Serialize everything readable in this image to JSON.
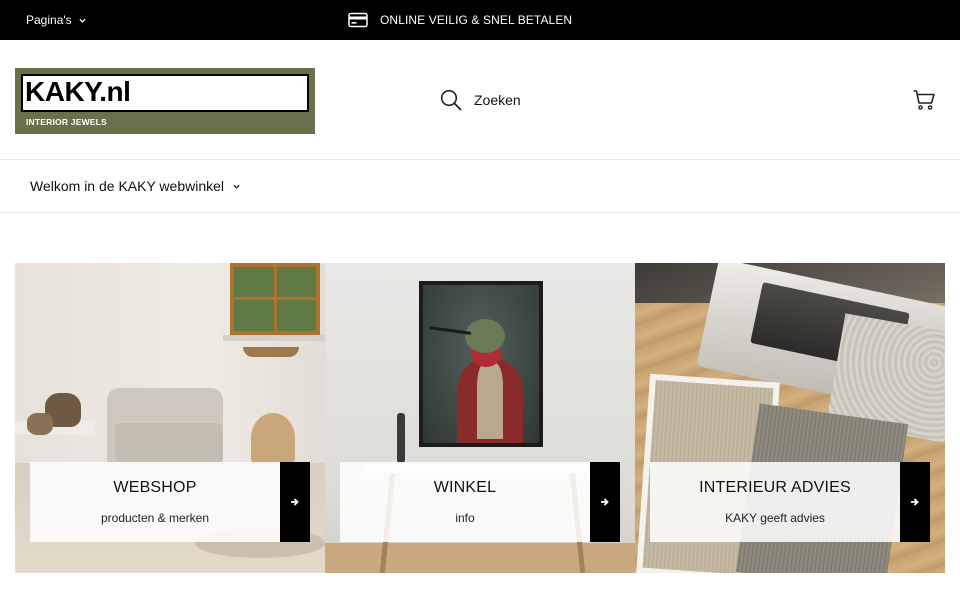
{
  "topbar": {
    "pages_label": "Pagina's",
    "promo_text": "ONLINE VEILIG & SNEL BETALEN"
  },
  "header": {
    "logo_name": "KAKY.nl",
    "logo_tagline": "INTERIOR JEWELS",
    "search_label": "Zoeken"
  },
  "nav": {
    "items": [
      {
        "label": "Welkom in de KAKY webwinkel"
      }
    ]
  },
  "tiles": [
    {
      "title": "WEBSHOP",
      "subtitle": "producten & merken"
    },
    {
      "title": "WINKEL",
      "subtitle": "info"
    },
    {
      "title": "INTERIEUR ADVIES",
      "subtitle": "KAKY geeft advies"
    }
  ],
  "colors": {
    "topbar_bg": "#000000",
    "logo_bg": "#6b704c",
    "accent": "#000000"
  },
  "icons": [
    "chevron-down-icon",
    "credit-card-icon",
    "search-icon",
    "cart-icon",
    "arrow-right-icon"
  ]
}
